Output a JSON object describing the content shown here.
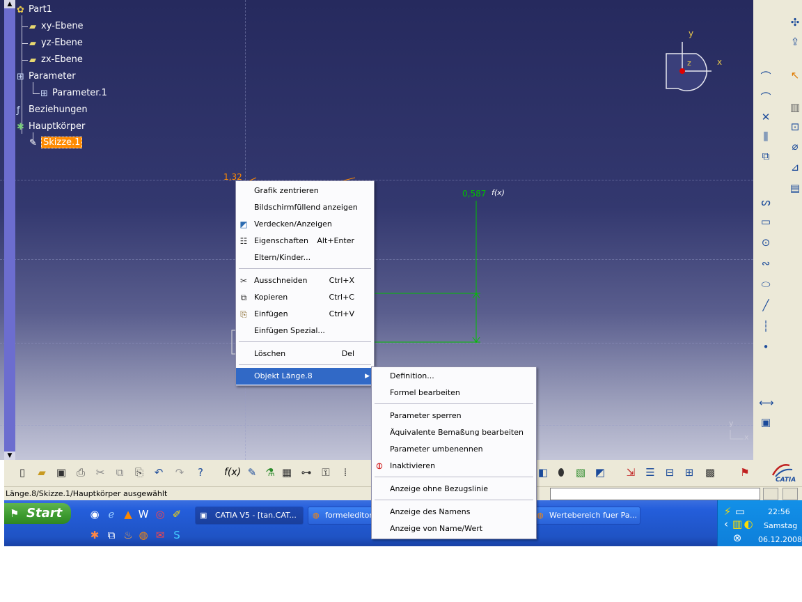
{
  "tree": {
    "root": "Part1",
    "items": [
      "xy-Ebene",
      "yz-Ebene",
      "zx-Ebene",
      "Parameter",
      "Parameter.1",
      "Beziehungen",
      "Hauptkörper",
      "Skizze.1"
    ]
  },
  "viewport": {
    "dim_label_1": "1,32",
    "dim_label_2": "0,587",
    "fx_mark": "f(x)",
    "compass_y": "y",
    "compass_x": "x",
    "compass_z": "z",
    "corner_y": "y",
    "corner_x": "x"
  },
  "context_menu": {
    "items": [
      {
        "label": "Grafik zentrieren",
        "shortcut": ""
      },
      {
        "label": "Bildschirmfüllend anzeigen",
        "shortcut": ""
      },
      {
        "label": "Verdecken/Anzeigen",
        "shortcut": ""
      },
      {
        "label": "Eigenschaften",
        "shortcut": "Alt+Enter"
      },
      {
        "label": "Eltern/Kinder...",
        "shortcut": ""
      },
      {
        "label": "Ausschneiden",
        "shortcut": "Ctrl+X"
      },
      {
        "label": "Kopieren",
        "shortcut": "Ctrl+C"
      },
      {
        "label": "Einfügen",
        "shortcut": "Ctrl+V"
      },
      {
        "label": "Einfügen Spezial...",
        "shortcut": ""
      },
      {
        "label": "Löschen",
        "shortcut": "Del"
      },
      {
        "label": "Objekt Länge.8",
        "shortcut": ""
      }
    ]
  },
  "submenu": {
    "items": [
      "Definition...",
      "Formel bearbeiten",
      "Parameter sperren",
      "Äquivalente Bemaßung bearbeiten",
      "Parameter umbenennen",
      "Inaktivieren",
      "Anzeige ohne Bezugslinie",
      "Anzeige des Namens",
      "Anzeige von Name/Wert"
    ]
  },
  "toolbar": {
    "fx_button": "f(x)",
    "catia_logo": "CATIA"
  },
  "status": {
    "text": "Länge.8/Skizze.1/Hauptkörper ausgewählt"
  },
  "taskbar": {
    "start": "Start",
    "tasks": [
      "CATIA V5 - [tan.CAT...",
      "formeleditor -",
      "Wertebereich fuer Pa..."
    ],
    "clock": "22:56",
    "day": "Samstag",
    "date": "06.12.2008"
  },
  "colors": {
    "viewport_top": "#262a5e",
    "selection": "#ff8a00",
    "dimension": "#00c000",
    "menu_highlight": "#3169c6",
    "taskbar": "#245edb"
  }
}
